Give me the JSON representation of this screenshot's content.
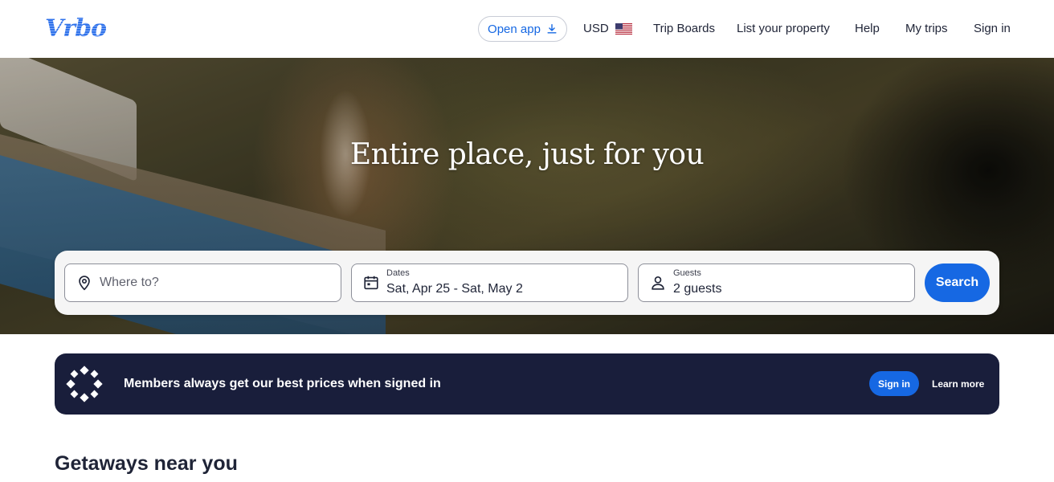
{
  "header": {
    "logo": "Vrbo",
    "open_app": "Open app",
    "currency": "USD",
    "nav": [
      "Trip Boards",
      "List your property",
      "Help",
      "My trips",
      "Sign in"
    ]
  },
  "hero": {
    "title": "Entire place, just for you"
  },
  "search": {
    "where_placeholder": "Where to?",
    "dates_label": "Dates",
    "dates_value": "Sat, Apr 25 - Sat, May 2",
    "guests_label": "Guests",
    "guests_value": "2 guests",
    "button": "Search"
  },
  "members": {
    "text": "Members always get our best prices when signed in",
    "sign_in": "Sign in",
    "learn_more": "Learn more"
  },
  "section": {
    "title": "Getaways near you"
  },
  "colors": {
    "accent": "#1668e3",
    "banner": "#191e3b"
  },
  "icons": {
    "open_app": "download-icon",
    "currency": "us-flag-icon",
    "where": "location-pin-icon",
    "dates": "calendar-icon",
    "guests": "person-icon",
    "members": "members-badge-icon"
  }
}
